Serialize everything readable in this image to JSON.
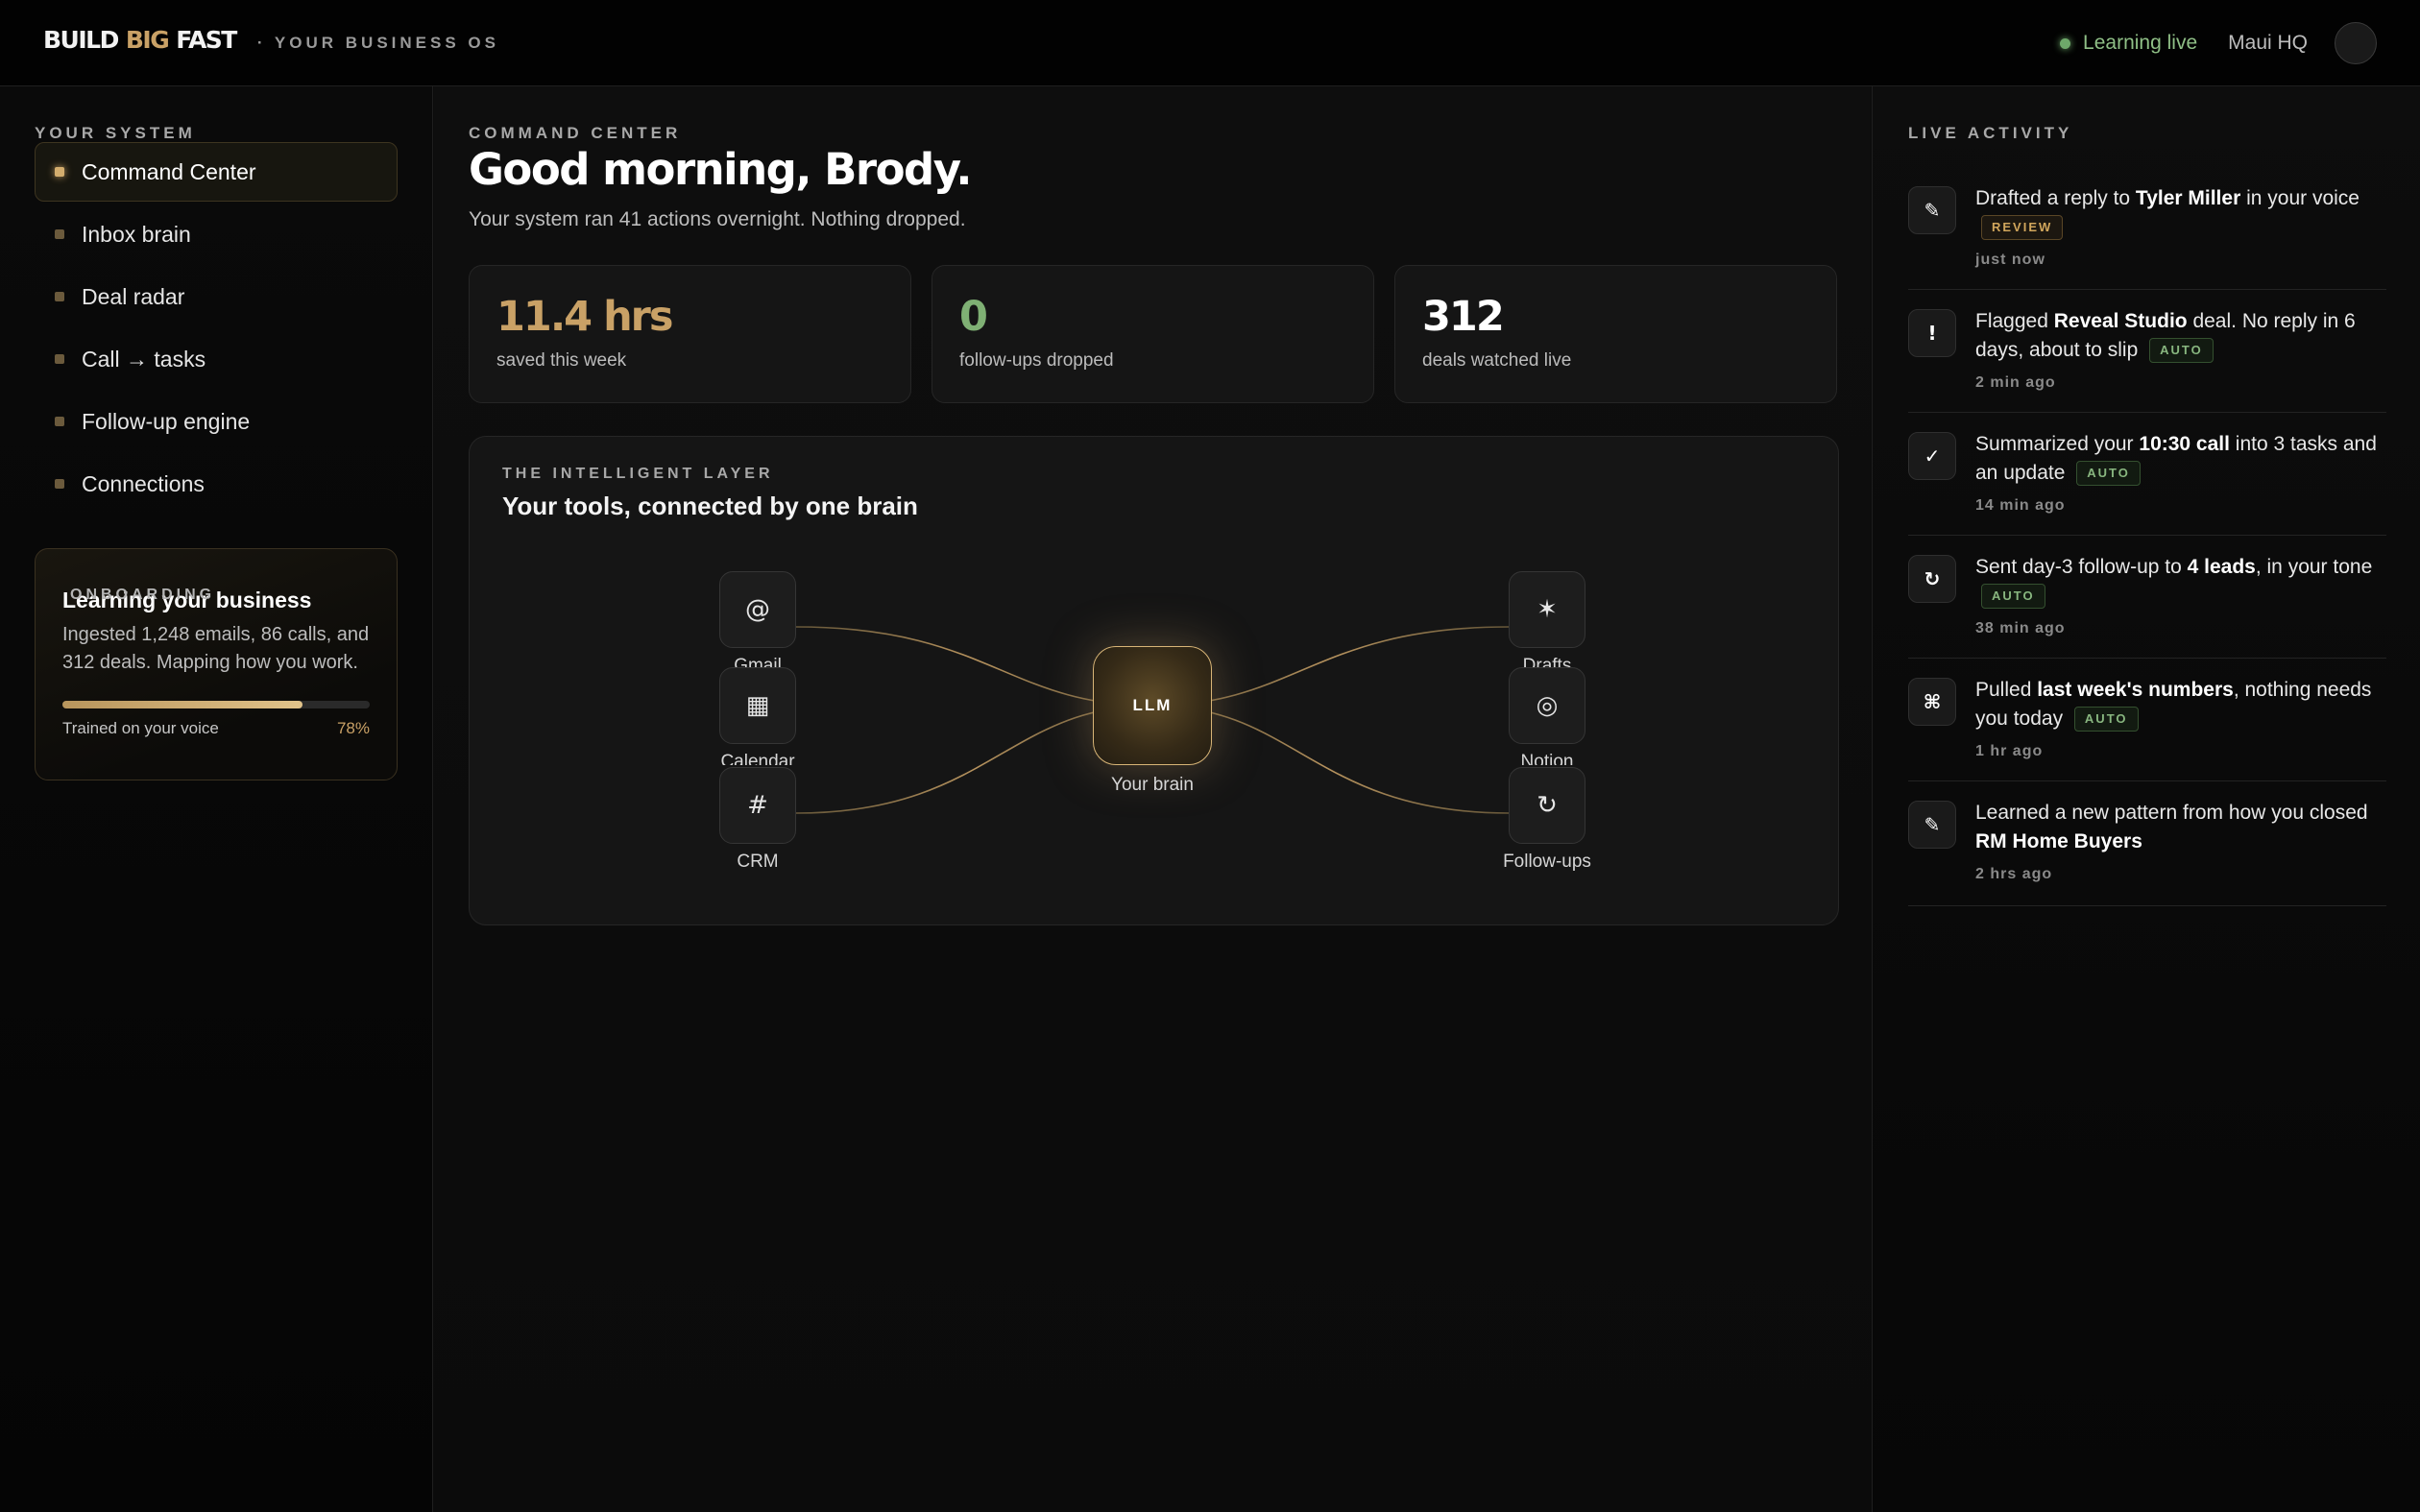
{
  "header": {
    "brand_part1": "BUILD",
    "brand_part2": "BIG",
    "brand_part3": "FAST",
    "tagline": "· YOUR BUSINESS OS",
    "status_label": "Learning live",
    "workspace": "Maui HQ"
  },
  "sidebar": {
    "section_label": "YOUR SYSTEM",
    "items": [
      {
        "label": "Command Center",
        "active": true
      },
      {
        "label": "Inbox brain"
      },
      {
        "label": "Deal radar"
      },
      {
        "label": "Call → tasks"
      },
      {
        "label": "Follow-up engine"
      },
      {
        "label": "Connections"
      }
    ],
    "onboarding": {
      "section_label": "ONBOARDING",
      "title": "Learning your business",
      "description": "Ingested 1,248 emails, 86 calls, and 312 deals. Mapping how you work.",
      "progress_label": "Trained on your voice",
      "progress_text": "78%",
      "progress_value": 0.78
    }
  },
  "main": {
    "section_label": "COMMAND CENTER",
    "greeting": "Good morning, Brody.",
    "subtitle": "Your system ran 41 actions overnight. Nothing dropped.",
    "stats": [
      {
        "value": "11.4 hrs",
        "label": "saved this week",
        "color": "#c9a166"
      },
      {
        "value": "0",
        "label": "follow-ups dropped",
        "color": "#7fb074"
      },
      {
        "value": "312",
        "label": "deals watched live",
        "color": "#ffffff"
      }
    ],
    "layer": {
      "section_label": "THE INTELLIGENT LAYER",
      "title": "Your tools, connected by one brain",
      "brain_badge": "LLM",
      "brain_label": "Your brain",
      "nodes": {
        "gmail": {
          "label": "Gmail",
          "icon": "at-icon",
          "glyph": "@"
        },
        "calendar": {
          "label": "Calendar",
          "icon": "calendar-icon",
          "glyph": "▦"
        },
        "crm": {
          "label": "CRM",
          "icon": "hash-icon",
          "glyph": "#"
        },
        "drafts": {
          "label": "Drafts",
          "icon": "sparkle-icon",
          "glyph": "✶"
        },
        "notion": {
          "label": "Notion",
          "icon": "circle-icon",
          "glyph": "◎"
        },
        "followups": {
          "label": "Follow-ups",
          "icon": "refresh-icon",
          "glyph": "↻"
        }
      }
    }
  },
  "activity": {
    "section_label": "LIVE ACTIVITY",
    "items": [
      {
        "icon": "pencil-icon",
        "glyph": "✎",
        "pre": "Drafted a reply to ",
        "strong": "Tyler Miller",
        "post": " in your voice",
        "badge": "REVIEW",
        "badge_type": "review",
        "time": "just now"
      },
      {
        "icon": "alert-icon",
        "glyph": "!",
        "pre": "Flagged ",
        "strong": "Reveal Studio",
        "post": " deal. No reply in 6 days, about to slip",
        "badge": "AUTO",
        "badge_type": "auto",
        "time": "2 min ago"
      },
      {
        "icon": "check-icon",
        "glyph": "✓",
        "pre": "Summarized your ",
        "strong": "10:30 call",
        "post": " into 3 tasks and an update",
        "badge": "AUTO",
        "badge_type": "auto",
        "time": "14 min ago"
      },
      {
        "icon": "refresh-icon",
        "glyph": "↻",
        "pre": "Sent day-3 follow-up to ",
        "strong": "4 leads",
        "post": ", in your tone",
        "badge": "AUTO",
        "badge_type": "auto",
        "time": "38 min ago"
      },
      {
        "icon": "command-icon",
        "glyph": "⌘",
        "pre": "Pulled ",
        "strong": "last week's numbers",
        "post": ", nothing needs you today",
        "badge": "AUTO",
        "badge_type": "auto",
        "time": "1 hr ago"
      },
      {
        "icon": "pencil-icon",
        "glyph": "✎",
        "pre": "Learned a new pattern from how you closed ",
        "strong": "RM Home Buyers",
        "post": "",
        "badge": "",
        "badge_type": "",
        "time": "2 hrs ago"
      }
    ]
  }
}
